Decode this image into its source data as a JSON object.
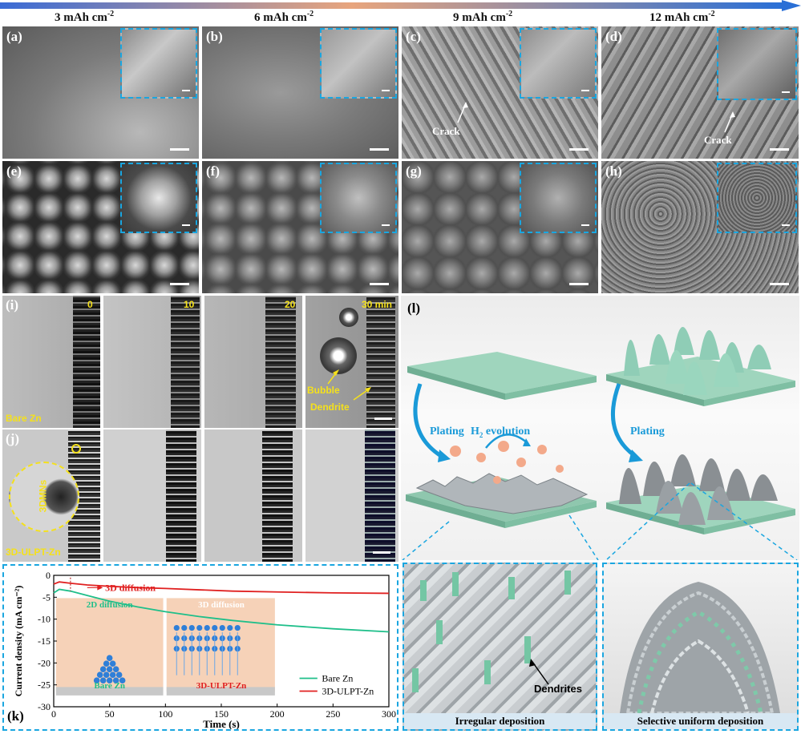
{
  "headers": [
    {
      "label": "3 mAh cm",
      "sup": "-2"
    },
    {
      "label": "6 mAh cm",
      "sup": "-2"
    },
    {
      "label": "9 mAh cm",
      "sup": "-2"
    },
    {
      "label": "12 mAh cm",
      "sup": "-2"
    }
  ],
  "sem_labels": {
    "a": "(a)",
    "b": "(b)",
    "c": "(c)",
    "d": "(d)",
    "e": "(e)",
    "f": "(f)",
    "g": "(g)",
    "h": "(h)"
  },
  "crack_label": "Crack",
  "panel_i": {
    "label": "(i)",
    "times": [
      "0",
      "10",
      "20",
      "30 min"
    ],
    "sample": "Bare Zn",
    "bubble": "Bubble",
    "dendrite": "Dendrite"
  },
  "panel_j": {
    "label": "(j)",
    "sample": "3D-ULPT-Zn",
    "zoom": "3DMNs"
  },
  "panel_k": {
    "label": "(k)",
    "annotation": "3D diffusion",
    "inset_left_title": "2D diffusion",
    "inset_left_caption": "Bare Zn",
    "inset_right_title": "3D diffusion",
    "inset_right_caption": "3D-ULPT-Zn"
  },
  "panel_l": {
    "label": "(l)",
    "plating_left": "Plating",
    "h2": "H",
    "h2_sub": "2",
    "h2_rest": " evolution",
    "plating_right": "Plating",
    "dendrites": "Dendrites",
    "cap_left": "Irregular deposition",
    "cap_right": "Selective uniform deposition"
  },
  "chart_data": {
    "type": "line",
    "xlabel": "Time (s)",
    "ylabel": "Current density (mA cm⁻²)",
    "xlim": [
      0,
      300
    ],
    "ylim": [
      -30,
      0
    ],
    "xticks": [
      0,
      50,
      100,
      150,
      200,
      250,
      300
    ],
    "yticks": [
      0,
      -5,
      -10,
      -15,
      -20,
      -25,
      -30
    ],
    "legend_position": "bottom-right",
    "series": [
      {
        "name": "Bare Zn",
        "color": "#1fbf8a",
        "x": [
          0,
          5,
          15,
          30,
          50,
          75,
          100,
          130,
          160,
          200,
          250,
          300
        ],
        "y": [
          -4.0,
          -3.2,
          -3.6,
          -4.6,
          -5.9,
          -7.2,
          -8.3,
          -9.4,
          -10.3,
          -11.3,
          -12.2,
          -12.9
        ]
      },
      {
        "name": "3D-ULPT-Zn",
        "color": "#e02020",
        "x": [
          0,
          5,
          15,
          30,
          50,
          75,
          100,
          130,
          160,
          200,
          250,
          300
        ],
        "y": [
          -2.0,
          -1.5,
          -1.8,
          -2.2,
          -2.5,
          -2.8,
          -3.0,
          -3.3,
          -3.6,
          -3.8,
          -4.0,
          -4.1
        ]
      }
    ]
  },
  "colors": {
    "accent": "#1aa6e0",
    "bare": "#1fbf8a",
    "ulpt": "#e02020",
    "yellow": "#f5e11b"
  }
}
